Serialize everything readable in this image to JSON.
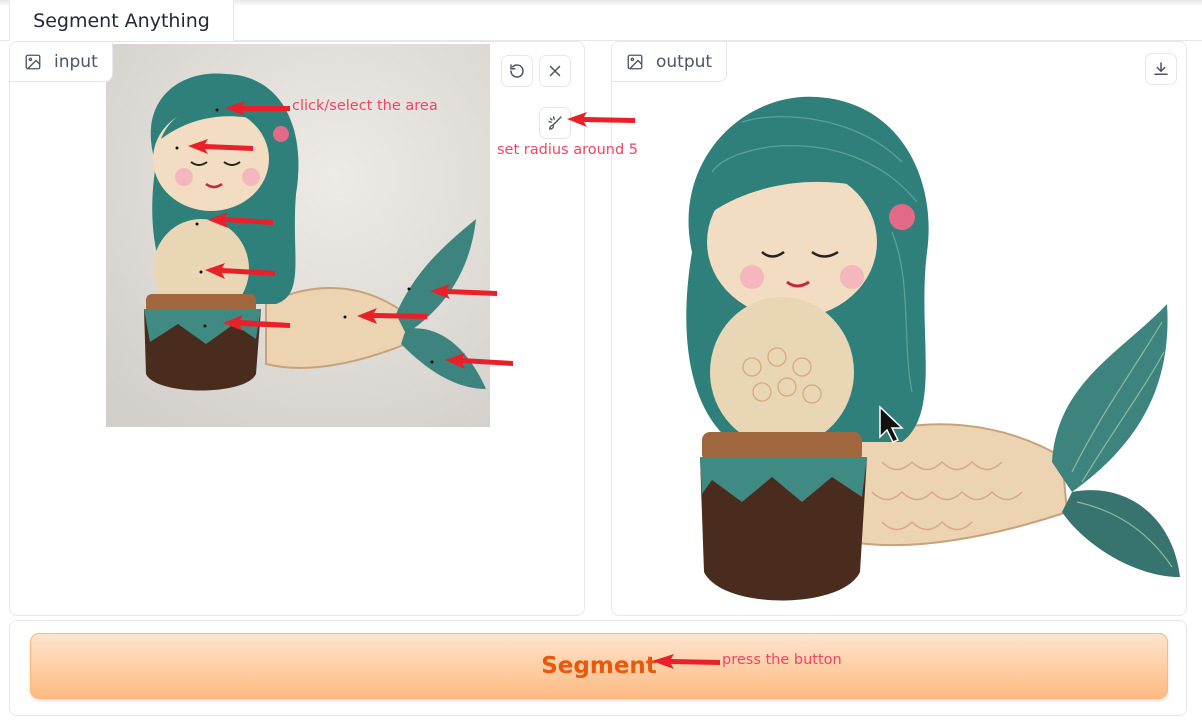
{
  "tab": {
    "label": "Segment Anything"
  },
  "input_panel": {
    "label": "input",
    "icon": "image-icon",
    "undo_icon": "undo-icon",
    "clear_icon": "close-icon",
    "brush_icon": "brush-icon"
  },
  "output_panel": {
    "label": "output",
    "icon": "image-icon",
    "download_icon": "download-icon"
  },
  "annotations": {
    "click": "click/select the area",
    "radius": "set radius around 5",
    "press": "press the button"
  },
  "segment_button": {
    "label": "Segment"
  },
  "colors": {
    "accent": "#ea580c",
    "annotation": "#ef4463",
    "arrow": "#e8202a",
    "teal": "#2f7f7a"
  }
}
